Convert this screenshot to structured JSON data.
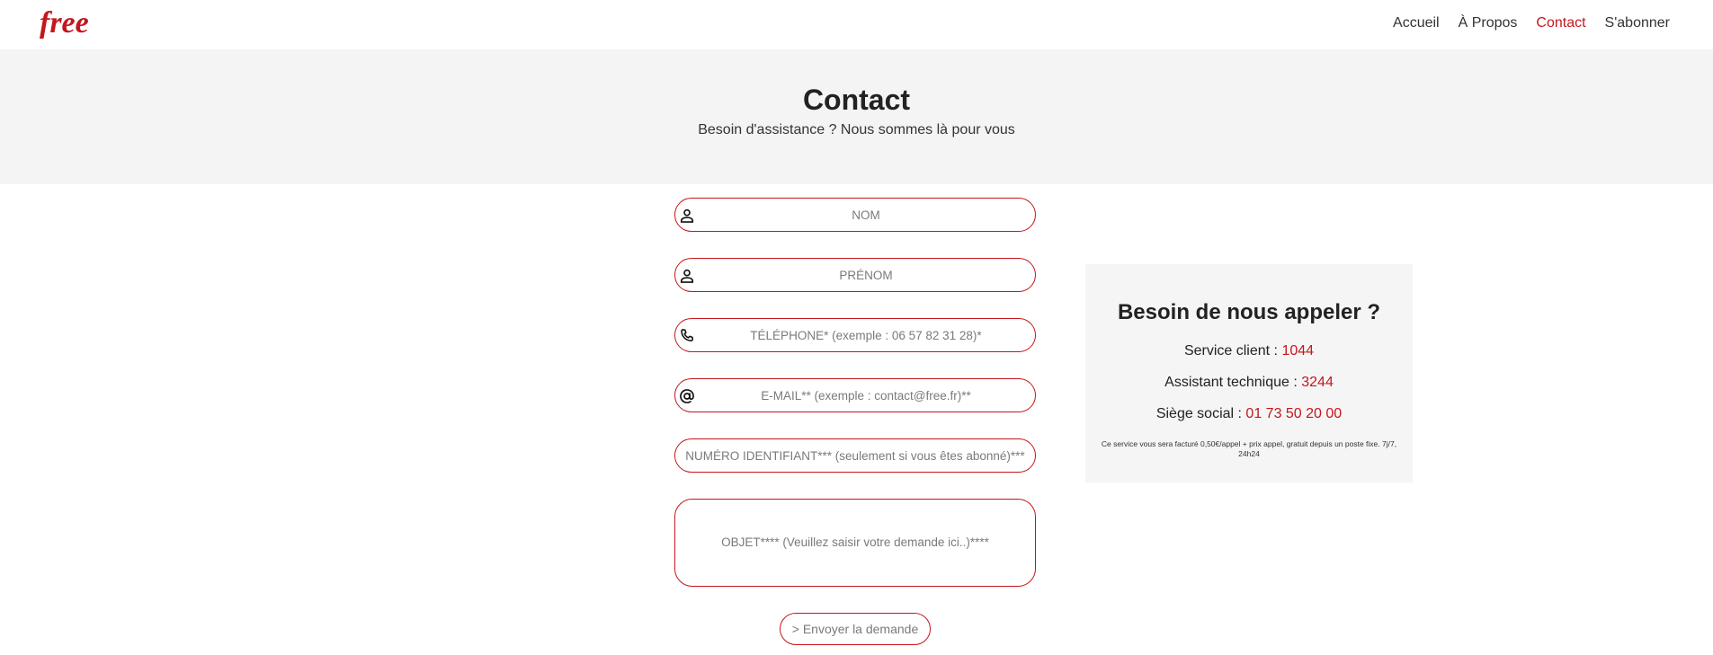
{
  "brand": {
    "logo_text": "free",
    "accent_color": "#c4161c"
  },
  "nav": {
    "items": [
      {
        "label": "Accueil"
      },
      {
        "label": "À Propos"
      },
      {
        "label": "Contact",
        "active": true
      },
      {
        "label": "S'abonner"
      }
    ]
  },
  "hero": {
    "title": "Contact",
    "subtitle": "Besoin d'assistance ? Nous sommes là pour vous"
  },
  "form": {
    "nom_placeholder": "NOM",
    "prenom_placeholder": "PRÉNOM",
    "telephone_placeholder": "TÉLÉPHONE* (exemple : 06 57 82 31 28)*",
    "email_placeholder": "E-MAIL** (exemple : contact@free.fr)**",
    "identifiant_placeholder": "NUMÉRO IDENTIFIANT*** (seulement si vous êtes abonné)***",
    "objet_placeholder": "OBJET**** (Veuillez saisir votre demande ici..)****",
    "submit_label": "> Envoyer la demande"
  },
  "callbox": {
    "title": "Besoin de nous appeler ?",
    "service_label": "Service client : ",
    "service_number": "1044",
    "assistant_label": "Assistant technique : ",
    "assistant_number": "3244",
    "siege_label": "Siège social : ",
    "siege_number": "01 73 50 20 00",
    "fine_print": "Ce service vous sera facturé 0,50€/appel + prix appel, gratuit depuis un poste fixe. 7j/7, 24h24"
  },
  "icons": [
    "free-logo",
    "person-icon",
    "phone-icon",
    "at-sign-icon"
  ]
}
